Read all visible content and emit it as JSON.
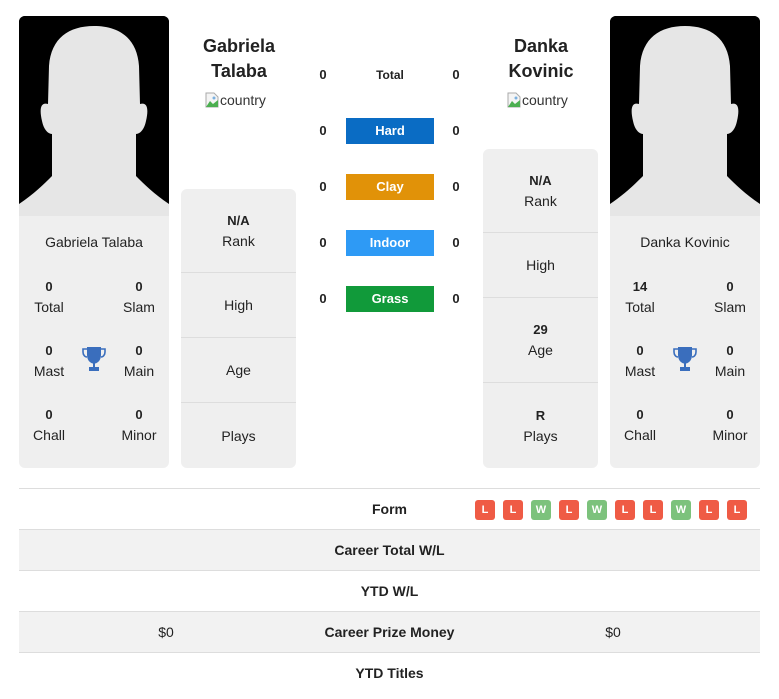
{
  "colors": {
    "hard": "#0a6cc4",
    "clay": "#e19208",
    "indoor": "#2e9af5",
    "grass": "#119a3a",
    "win": "#7cc27c",
    "loss": "#ef5b45",
    "trophy": "#3a6ebd"
  },
  "player1": {
    "header_name_line1": "Gabriela",
    "header_name_line2": "Talaba",
    "country_alt": "country",
    "card_name": "Gabriela Talaba",
    "stats": {
      "total": {
        "value": "0",
        "label": "Total"
      },
      "slam": {
        "value": "0",
        "label": "Slam"
      },
      "mast": {
        "value": "0",
        "label": "Mast"
      },
      "main": {
        "value": "0",
        "label": "Main"
      },
      "chall": {
        "value": "0",
        "label": "Chall"
      },
      "minor": {
        "value": "0",
        "label": "Minor"
      }
    },
    "info": {
      "rank": {
        "value": "N/A",
        "label": "Rank"
      },
      "high": {
        "value": "",
        "label": "High"
      },
      "age": {
        "value": "",
        "label": "Age"
      },
      "plays": {
        "value": "",
        "label": "Plays"
      }
    }
  },
  "player2": {
    "header_name_line1": "Danka",
    "header_name_line2": "Kovinic",
    "country_alt": "country",
    "card_name": "Danka Kovinic",
    "stats": {
      "total": {
        "value": "14",
        "label": "Total"
      },
      "slam": {
        "value": "0",
        "label": "Slam"
      },
      "mast": {
        "value": "0",
        "label": "Mast"
      },
      "main": {
        "value": "0",
        "label": "Main"
      },
      "chall": {
        "value": "0",
        "label": "Chall"
      },
      "minor": {
        "value": "0",
        "label": "Minor"
      }
    },
    "info": {
      "rank": {
        "value": "N/A",
        "label": "Rank"
      },
      "high": {
        "value": "",
        "label": "High"
      },
      "age": {
        "value": "29",
        "label": "Age"
      },
      "plays": {
        "value": "R",
        "label": "Plays"
      }
    }
  },
  "surfaces": [
    {
      "label": "Total",
      "p1": "0",
      "p2": "0"
    },
    {
      "label": "Hard",
      "p1": "0",
      "p2": "0"
    },
    {
      "label": "Clay",
      "p1": "0",
      "p2": "0"
    },
    {
      "label": "Indoor",
      "p1": "0",
      "p2": "0"
    },
    {
      "label": "Grass",
      "p1": "0",
      "p2": "0"
    }
  ],
  "table": {
    "rows": [
      {
        "label": "Form",
        "p1": "",
        "p2": ""
      },
      {
        "label": "Career Total W/L",
        "p1": "",
        "p2": ""
      },
      {
        "label": "YTD W/L",
        "p1": "",
        "p2": ""
      },
      {
        "label": "Career Prize Money",
        "p1": "$0",
        "p2": "$0"
      },
      {
        "label": "YTD Titles",
        "p1": "",
        "p2": ""
      }
    ],
    "form_p2": [
      "L",
      "L",
      "W",
      "L",
      "W",
      "L",
      "L",
      "W",
      "L",
      "L"
    ]
  }
}
